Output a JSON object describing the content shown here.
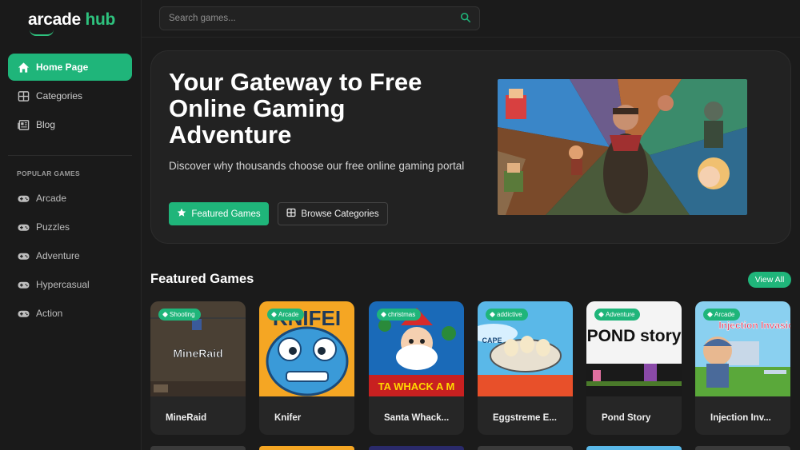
{
  "brand": {
    "name_main": "arcade",
    "name_accent": "hub"
  },
  "search": {
    "placeholder": "Search games..."
  },
  "nav": [
    {
      "label": "Home Page",
      "icon": "home-icon",
      "active": true
    },
    {
      "label": "Categories",
      "icon": "grid-icon"
    },
    {
      "label": "Blog",
      "icon": "newspaper-icon"
    }
  ],
  "popular": {
    "heading": "POPULAR GAMES",
    "items": [
      {
        "label": "Arcade",
        "icon": "gamepad-icon"
      },
      {
        "label": "Puzzles",
        "icon": "gamepad-icon"
      },
      {
        "label": "Adventure",
        "icon": "gamepad-icon"
      },
      {
        "label": "Hypercasual",
        "icon": "gamepad-icon"
      },
      {
        "label": "Action",
        "icon": "gamepad-icon"
      }
    ]
  },
  "hero": {
    "title": "Your Gateway to Free Online Gaming Adventure",
    "subtitle": "Discover why thousands choose our free online gaming portal",
    "primary_button": "Featured Games",
    "secondary_button": "Browse Categories"
  },
  "featured": {
    "heading": "Featured Games",
    "view_all": "View All",
    "games": [
      {
        "name": "MineRaid",
        "tag": "Shooting",
        "thumb_text": "MineRaid"
      },
      {
        "name": "Knifer",
        "tag": "Arcade",
        "thumb_text": "KNIFEI"
      },
      {
        "name": "Santa Whack...",
        "tag": "christmas",
        "thumb_text": "TA WHACK A M"
      },
      {
        "name": "Eggstreme E...",
        "tag": "addictive",
        "thumb_text": "CAPE"
      },
      {
        "name": "Pond Story",
        "tag": "Adventure",
        "thumb_text": "POND story"
      },
      {
        "name": "Injection Inv...",
        "tag": "Arcade",
        "thumb_text": "Injection Invasion"
      }
    ]
  },
  "colors": {
    "accent": "#1fb57a",
    "background": "#1b1b1b",
    "panel": "#222222"
  }
}
